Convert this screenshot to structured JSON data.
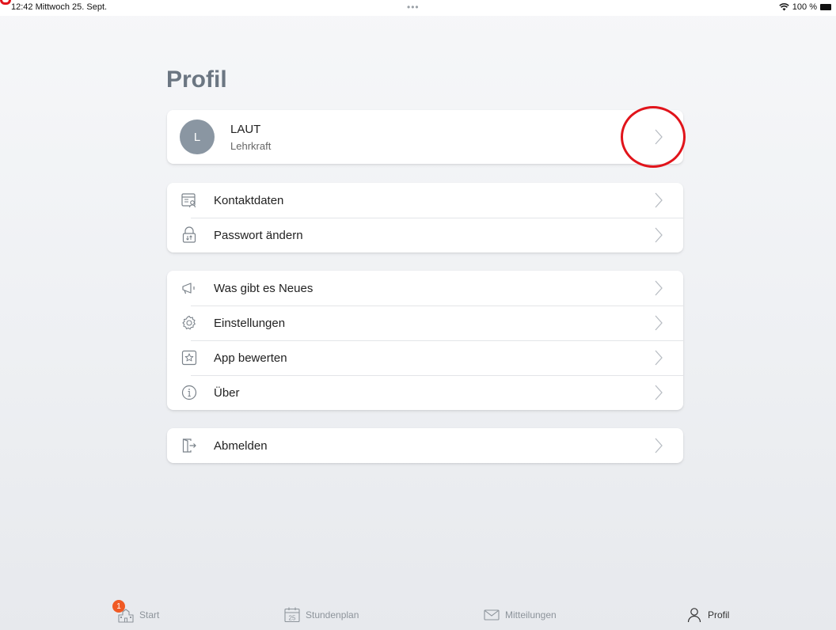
{
  "status_bar": {
    "time_date": "12:42  Mittwoch 25. Sept.",
    "dots": "•••",
    "battery_text": "100 %"
  },
  "page": {
    "title": "Profil"
  },
  "profile": {
    "avatar_initial": "L",
    "name": "LAUT",
    "role": "Lehrkraft"
  },
  "account_group": [
    {
      "label": "Kontaktdaten",
      "icon": "contact-card-icon"
    },
    {
      "label": "Passwort ändern",
      "icon": "lock-icon"
    }
  ],
  "info_group": [
    {
      "label": "Was gibt es Neues",
      "icon": "megaphone-icon"
    },
    {
      "label": "Einstellungen",
      "icon": "gear-icon"
    },
    {
      "label": "App bewerten",
      "icon": "star-icon"
    },
    {
      "label": "Über",
      "icon": "info-icon"
    }
  ],
  "logout_group": [
    {
      "label": "Abmelden",
      "icon": "logout-icon"
    }
  ],
  "tab_bar": {
    "items": [
      {
        "label": "Start",
        "icon": "school-icon",
        "badge": "1"
      },
      {
        "label": "Stundenplan",
        "icon": "calendar-icon",
        "calendar_day": "25"
      },
      {
        "label": "Mitteilungen",
        "icon": "mail-icon"
      },
      {
        "label": "Profil",
        "icon": "person-icon",
        "active": true
      }
    ]
  },
  "colors": {
    "accent_red": "#e1141b",
    "badge_orange": "#f05a24",
    "title_gray": "#6b7682",
    "avatar_gray": "#8a96a2"
  }
}
